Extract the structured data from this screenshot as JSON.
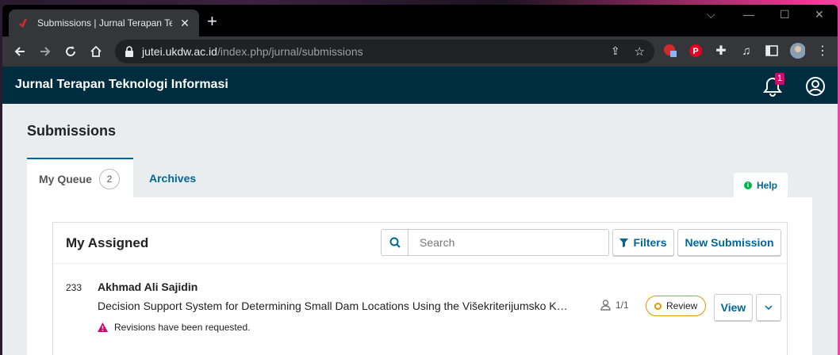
{
  "browser": {
    "tab_title": "Submissions | Jurnal Terapan Tekno",
    "url_host": "jutei.ukdw.ac.id",
    "url_path": "/index.php/jurnal/submissions"
  },
  "site": {
    "title": "Jurnal Terapan Teknologi Informasi",
    "notification_count": "1"
  },
  "page": {
    "title": "Submissions",
    "tabs": [
      {
        "label": "My Queue",
        "count": "2"
      },
      {
        "label": "Archives"
      }
    ],
    "help_label": "Help"
  },
  "list": {
    "title": "My Assigned",
    "search_placeholder": "Search",
    "filters_label": "Filters",
    "new_submission_label": "New Submission",
    "items": [
      {
        "id": "233",
        "author": "Akhmad Ali Sajidin",
        "title": "Decision Support System for Determining Small Dam Locations Using the Višekriterijumsko K…",
        "participants": "1/1",
        "status": "Review",
        "view_label": "View",
        "notice": "Revisions have been requested."
      }
    ]
  },
  "colors": {
    "header_bg": "#002c40",
    "link": "#006798",
    "review_status": "#d89b00",
    "alert": "#d00a6c"
  }
}
